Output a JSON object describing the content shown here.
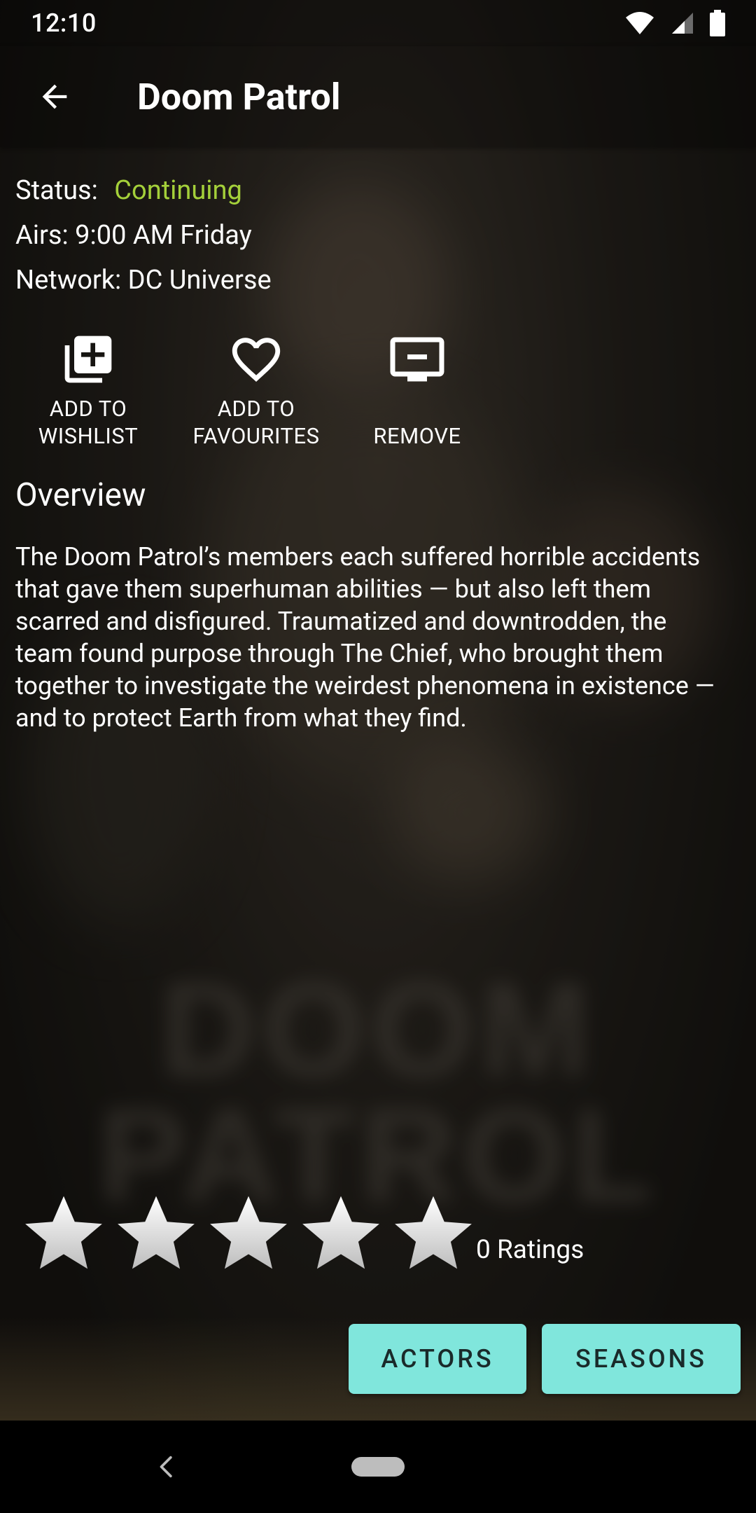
{
  "status_bar": {
    "time": "12:10",
    "icons": [
      "wifi-icon",
      "cell-signal-icon",
      "battery-icon"
    ]
  },
  "toolbar": {
    "title": "Doom Patrol",
    "back_icon": "arrow-back-icon"
  },
  "info": {
    "status_label": "Status:",
    "status_value": "Continuing",
    "status_color": "#a4d03a",
    "airs": "Airs: 9:00 AM Friday",
    "network": "Network: DC Universe"
  },
  "actions": [
    {
      "label": "ADD TO\nWISHLIST",
      "icon": "add-to-library-icon"
    },
    {
      "label": "ADD TO\nFAVOURITES",
      "icon": "heart-outline-icon"
    },
    {
      "label": "REMOVE",
      "icon": "remove-from-queue-icon"
    }
  ],
  "overview": {
    "heading": "Overview",
    "text": "The Doom Patrol’s members each suffered horrible accidents that gave them superhuman abilities — but also left them scarred and disfigured. Traumatized and downtrodden, the team found purpose through The Chief, who brought them together to investigate the weirdest phenomena in existence — and to protect Earth from what they find."
  },
  "rating": {
    "stars_total": 5,
    "stars_filled": 0,
    "count_label": "0 Ratings"
  },
  "buttons": {
    "actors": "ACTORS",
    "seasons": "SEASONS",
    "accent_color": "#80e6dc"
  },
  "background": {
    "poster_text": "DOOM PATROL"
  }
}
